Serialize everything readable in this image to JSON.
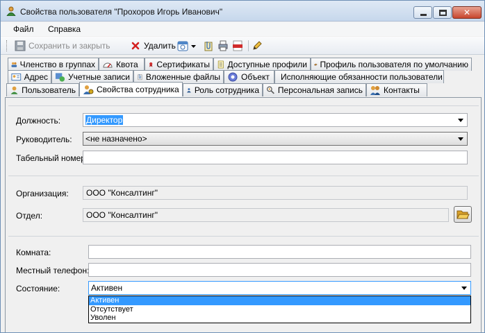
{
  "window": {
    "title": "Свойства пользователя \"Прохоров Игорь Иванович\"",
    "close_glyph": "✕"
  },
  "menu": {
    "items": [
      "Файл",
      "Справка"
    ]
  },
  "toolbar": {
    "save_close": "Сохранить и закрыть",
    "delete": "Удалить"
  },
  "tabs": {
    "row1": [
      "Членство в группах",
      "Квота",
      "Сертификаты",
      "Доступные профили",
      "Профиль пользователя по умолчанию"
    ],
    "row2": [
      "Адрес",
      "Учетные записи",
      "Вложенные файлы",
      "Объект",
      "Исполняющие обязанности пользователи"
    ],
    "row3": [
      "Пользователь",
      "Свойства сотрудника",
      "Роль сотрудника",
      "Персональная запись",
      "Контакты"
    ],
    "active": "Свойства сотрудника"
  },
  "form": {
    "position_label": "Должность:",
    "position_value": "Директор",
    "manager_label": "Руководитель:",
    "manager_value": "<не назначено>",
    "tabnum_label": "Табельный номер:",
    "tabnum_value": "",
    "org_label": "Организация:",
    "org_value": "ООО \"Консалтинг\"",
    "dept_label": "Отдел:",
    "dept_value": "ООО \"Консалтинг\"",
    "room_label": "Комната:",
    "room_value": "",
    "phone_label": "Местный телефон:",
    "phone_value": "",
    "state_label": "Состояние:",
    "state_value": "Активен",
    "state_options": [
      "Активен",
      "Отсутствует",
      "Уволен"
    ]
  },
  "colors": {
    "selection": "#3399ff",
    "title_bar": "#c6d7ec"
  }
}
